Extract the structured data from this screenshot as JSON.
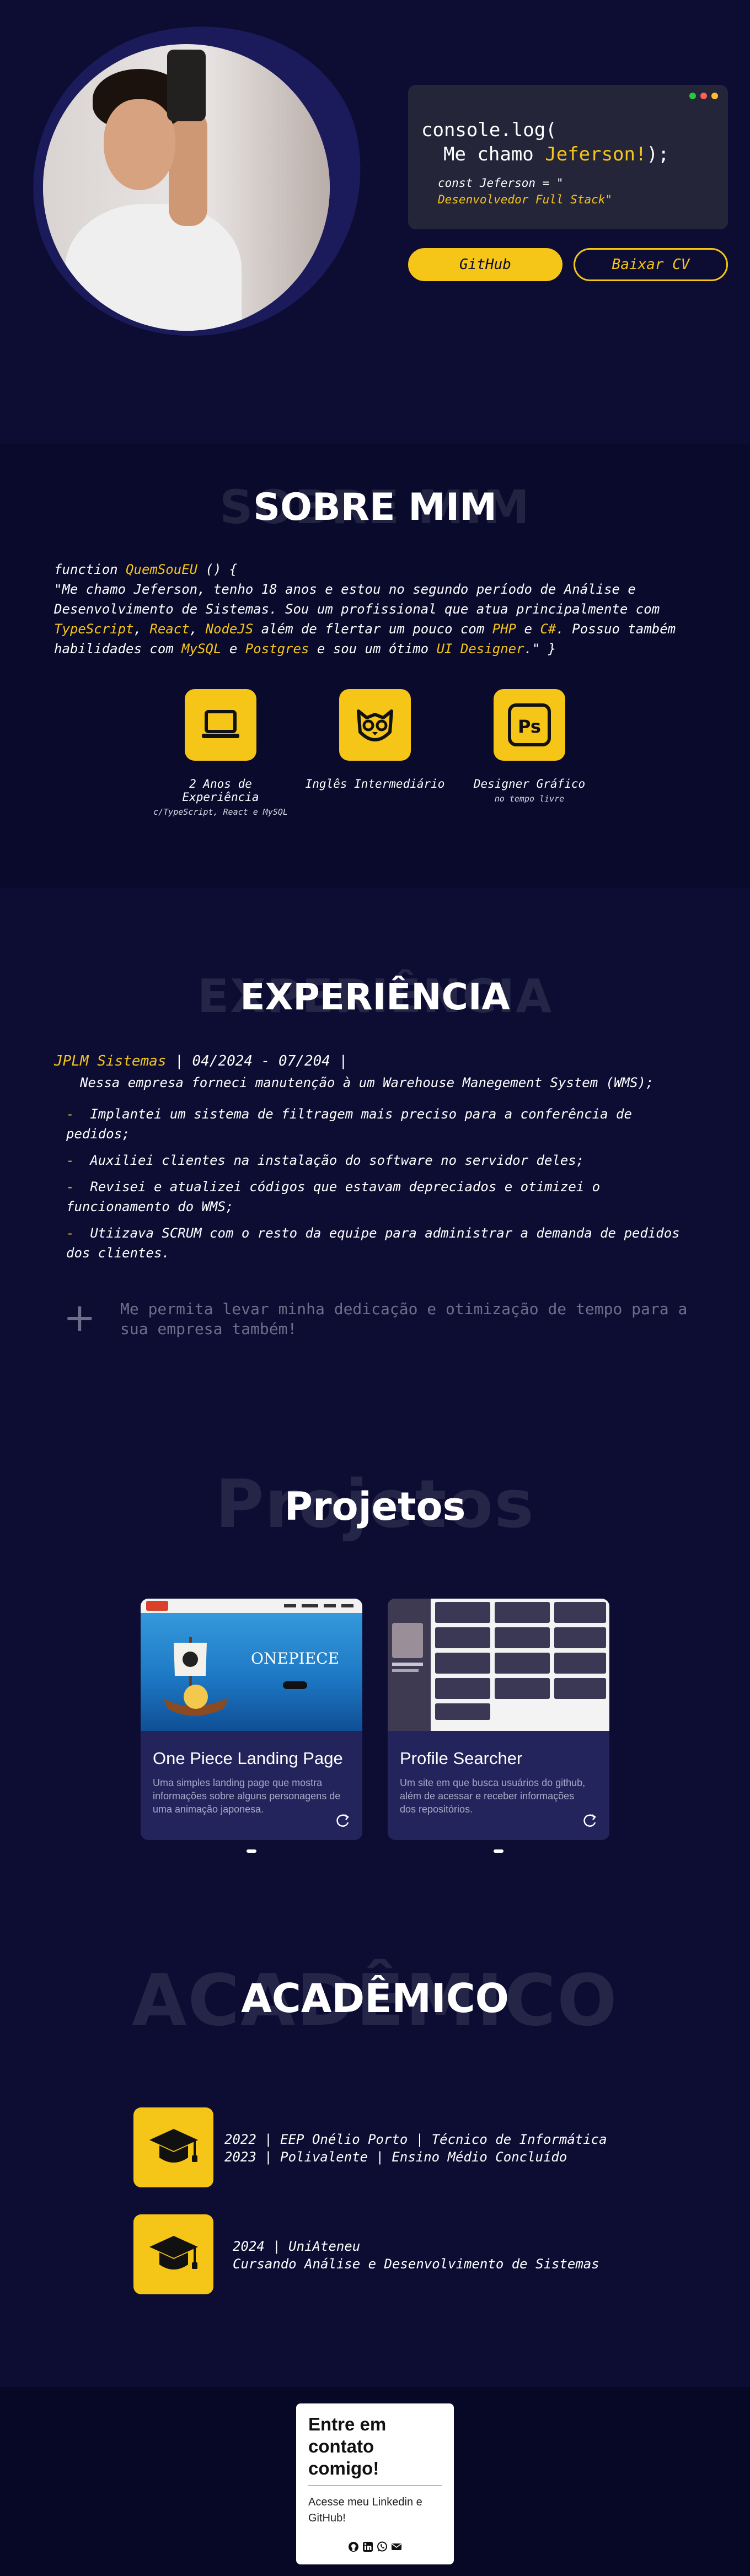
{
  "hero": {
    "code_line1": "console.log(",
    "code_line2_prefix": "Me chamo ",
    "code_line2_name": "Jeferson!",
    "code_line2_suffix": ");",
    "code_line3": "const Jeferson = \"",
    "code_line4": "Desenvolvedor Full Stack\"",
    "btn_github": "GitHub",
    "btn_cv": "Baixar CV",
    "window_dot_colors": [
      "#27c93f",
      "#ff5f56",
      "#ffbd2e"
    ]
  },
  "about": {
    "ghost": "SOBRE MIM",
    "title": "SOBRE MIM",
    "fn_prefix": "function ",
    "fn_name": "QuemSouEU",
    "fn_suffix": " () {",
    "p1": "\"Me chamo Jeferson, tenho 18 anos e estou no segundo período de Análise e Desenvolvimento de Sistemas. Sou um profissional que atua principalmente com ",
    "ts": "TypeScript",
    "sep1": ", ",
    "react": "React",
    "sep2": ", ",
    "node": "NodeJS",
    "p2": " além de flertar um pouco com ",
    "php": "PHP",
    "p3": " e ",
    "csharp": "C#",
    "p4": ". Possuo também habilidades com ",
    "mysql": "MySQL",
    "p5": " e ",
    "postgres": "Postgres",
    "p6": " e sou um ótimo ",
    "uid": "UI Designer",
    "p7": ".\" }",
    "skills": [
      {
        "icon": "laptop-icon",
        "title": "2 Anos de Experiência",
        "sub": "c/TypeScript, React e MySQL"
      },
      {
        "icon": "owl-icon",
        "title": "Inglês Intermediário",
        "sub": ""
      },
      {
        "icon": "photoshop-icon",
        "title": "Designer Gráfico",
        "sub": "no tempo livre"
      }
    ]
  },
  "experience": {
    "ghost": "EXPERIÊNCIA",
    "title": "EXPERIÊNCIA",
    "company": "JPLM Sistemas",
    "period": " | 04/2024 - 07/204 |",
    "intro": "Nessa empresa forneci manutenção à um Warehouse Manegement System (WMS);",
    "items": [
      "Implantei um sistema de filtragem mais preciso para a conferência de pedidos;",
      "Auxiliei clientes na instalação do software no servidor deles;",
      "Revisei e atualizei códigos que estavam depreciados e otimizei o funcionamento do WMS;",
      "Utiizava SCRUM com o resto da equipe para administrar a demanda de pedidos dos clientes."
    ],
    "plus": "+",
    "cta": "Me permita levar minha dedicação e otimização de tempo para a sua empresa também!"
  },
  "projects": {
    "ghost": "Projetos",
    "title": "Projetos",
    "items": [
      {
        "name": "One Piece Landing Page",
        "desc": "Uma simples landing page que mostra informações sobre alguns personagens de uma animação japonesa.",
        "logo": "ONEPIECE"
      },
      {
        "name": "Profile Searcher",
        "desc": "Um site em que busca usuários do github, além de acessar e receber informações dos repositórios."
      }
    ]
  },
  "academic": {
    "ghost": "ACADÊMICO",
    "title": "ACADÊMICO",
    "items": [
      {
        "line1": "2022 | EEP Onélio Porto | Técnico de Informática",
        "line2": "2023 | Polivalente | Ensino Médio Concluído"
      },
      {
        "line1": "2024 | UniAteneu",
        "line2": "Cursando Análise e Desenvolvimento de Sistemas"
      }
    ]
  },
  "contact": {
    "title": "Entre em contato comigo!",
    "text": "Acesse meu Linkedin e GitHub!",
    "icons": [
      "github-icon",
      "linkedin-icon",
      "whatsapp-icon",
      "email-icon"
    ]
  },
  "colors": {
    "accent": "#f5c518",
    "bg": "#0d0d33",
    "card": "#24245c"
  }
}
